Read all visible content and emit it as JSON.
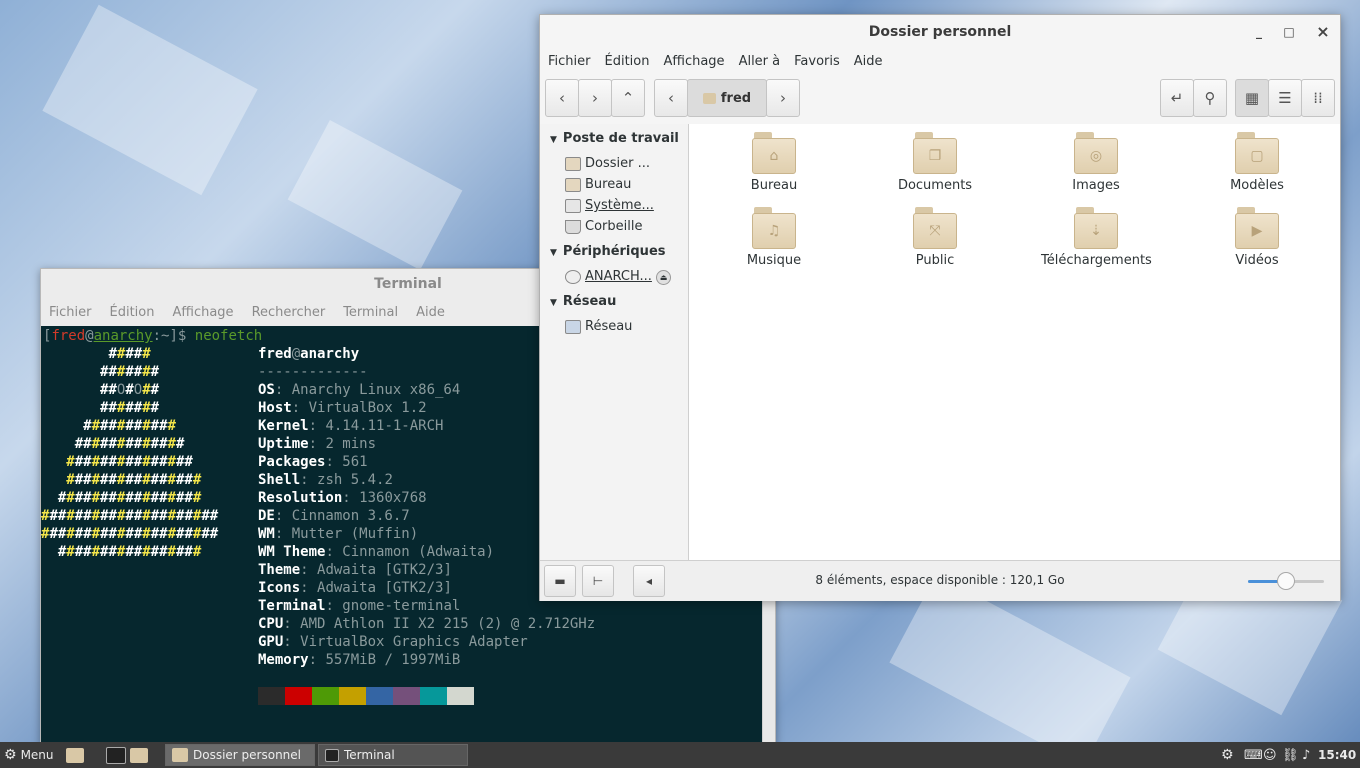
{
  "terminal": {
    "title": "Terminal",
    "menu": [
      "Fichier",
      "Édition",
      "Affichage",
      "Rechercher",
      "Terminal",
      "Aide"
    ],
    "prompt": {
      "open": "[",
      "user": "fred",
      "at": "@",
      "host": "anarchy",
      "path": ":~]$ ",
      "command": "neofetch"
    },
    "header": {
      "user": "fred",
      "at": "@",
      "host": "anarchy",
      "separator": "-------------"
    },
    "info": [
      {
        "key": "OS",
        "value": "Anarchy Linux x86_64"
      },
      {
        "key": "Host",
        "value": "VirtualBox 1.2"
      },
      {
        "key": "Kernel",
        "value": "4.14.11-1-ARCH"
      },
      {
        "key": "Uptime",
        "value": "2 mins"
      },
      {
        "key": "Packages",
        "value": "561"
      },
      {
        "key": "Shell",
        "value": "zsh 5.4.2"
      },
      {
        "key": "Resolution",
        "value": "1360x768"
      },
      {
        "key": "DE",
        "value": "Cinnamon 3.6.7"
      },
      {
        "key": "WM",
        "value": "Mutter (Muffin)"
      },
      {
        "key": "WM Theme",
        "value": "Cinnamon (Adwaita)"
      },
      {
        "key": "Theme",
        "value": "Adwaita [GTK2/3]"
      },
      {
        "key": "Icons",
        "value": "Adwaita [GTK2/3]"
      },
      {
        "key": "Terminal",
        "value": "gnome-terminal"
      },
      {
        "key": "CPU",
        "value": "AMD Athlon II X2 215 (2) @ 2.712GHz"
      },
      {
        "key": "GPU",
        "value": "VirtualBox Graphics Adapter"
      },
      {
        "key": "Memory",
        "value": "557MiB / 1997MiB"
      }
    ],
    "logo": [
      "        #####",
      "       #######",
      "       ##O#O##",
      "       #######",
      "     ###########",
      "    #############",
      "   ###############",
      "   ################",
      "  #################",
      "#####################",
      "#####################",
      "  #################"
    ],
    "palette": [
      "#2b2b2b",
      "#cc0000",
      "#4e9a06",
      "#c4a000",
      "#3465a4",
      "#75507b",
      "#06989a",
      "#d3d7cf"
    ]
  },
  "file_manager": {
    "title": "Dossier personnel",
    "window_controls": [
      "_",
      "□",
      "×"
    ],
    "menu": [
      "Fichier",
      "Édition",
      "Affichage",
      "Aller à",
      "Favoris",
      "Aide"
    ],
    "path_label": "fred",
    "sidebar": {
      "sections": [
        {
          "title": "Poste de travail",
          "items": [
            "Dossier ...",
            "Bureau",
            "Système...",
            "Corbeille"
          ]
        },
        {
          "title": "Périphériques",
          "items": [
            "ANARCH..."
          ]
        },
        {
          "title": "Réseau",
          "items": [
            "Réseau"
          ]
        }
      ]
    },
    "folders": [
      "Bureau",
      "Documents",
      "Images",
      "Modèles",
      "Musique",
      "Public",
      "Téléchargements",
      "Vidéos"
    ],
    "status": "8 éléments, espace disponible : 120,1 Go",
    "zoom_level": 0.5
  },
  "panel": {
    "menu_label": "Menu",
    "tasks": [
      "Dossier personnel",
      "Terminal"
    ],
    "clock": "15:40"
  }
}
